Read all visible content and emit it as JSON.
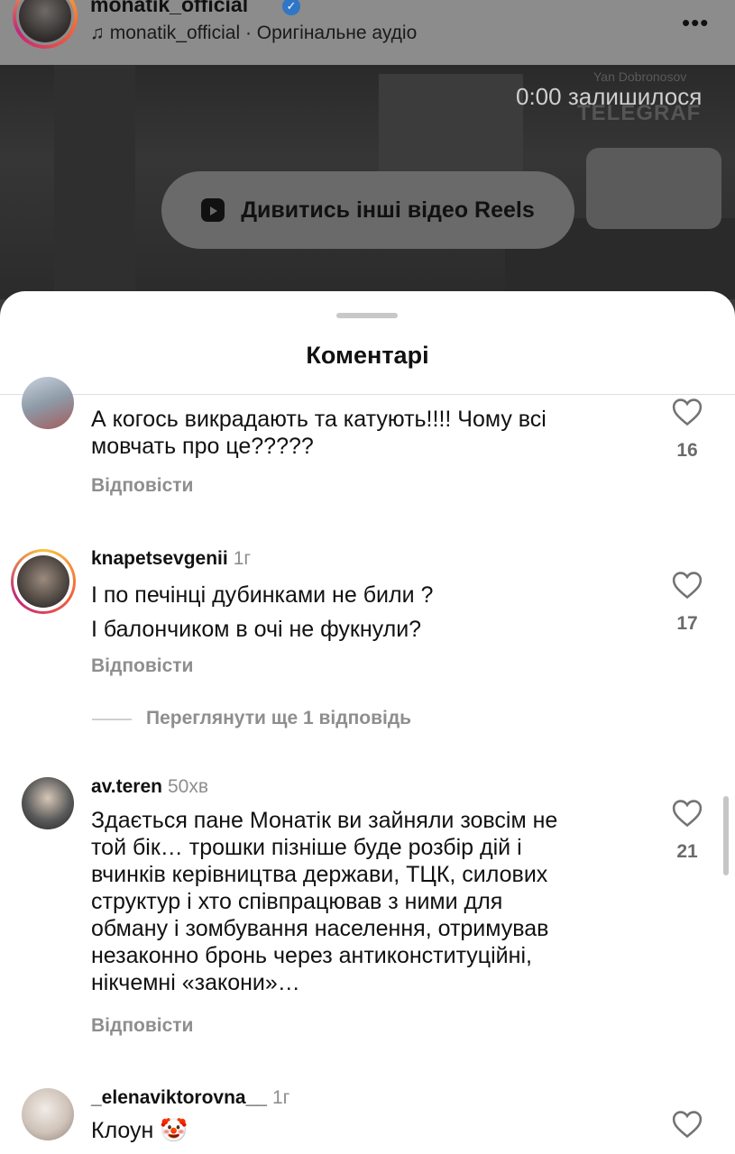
{
  "header": {
    "username": "monatik_official",
    "audio_label": "monatik_official · Оригінальне аудіо"
  },
  "video": {
    "credit": "Yan Dobronosov",
    "time_left": "0:00 залишилося",
    "watermark": "TELEGRAF",
    "reels_button_label": "Дивитись інші відео Reels"
  },
  "comments_sheet": {
    "title": "Коментарі",
    "comments": [
      {
        "username": "",
        "time": "",
        "text_lines": [
          "А когось викрадають та катують!!!! Чому всі",
          "мовчать про це?????"
        ],
        "likes": "16",
        "reply_label": "Відповісти"
      },
      {
        "username": "knapetsevgenii",
        "time": "1г",
        "text_lines": [
          "І по печінці дубинками не били ?",
          "І балончиком в очі не фукнули?"
        ],
        "likes": "17",
        "reply_label": "Відповісти",
        "view_replies": "Переглянути ще 1 відповідь"
      },
      {
        "username": "av.teren",
        "time": "50хв",
        "text_lines": [
          "Здається пане Монатік ви зайняли зовсім не",
          "той бік… трошки пізніше буде розбір дій і",
          "вчинків керівництва держави, ТЦК, силових",
          "структур і хто співпрацював з ними для",
          "обману і зомбування населення, отримував",
          "незаконно бронь через антиконституційні,",
          "нікчемні «закони»…"
        ],
        "likes": "21",
        "reply_label": "Відповісти"
      },
      {
        "username": "_elenaviktorovna__",
        "time": "1г",
        "text_lines": [
          "Клоун 🤡"
        ],
        "likes": "",
        "reply_label": ""
      }
    ]
  }
}
